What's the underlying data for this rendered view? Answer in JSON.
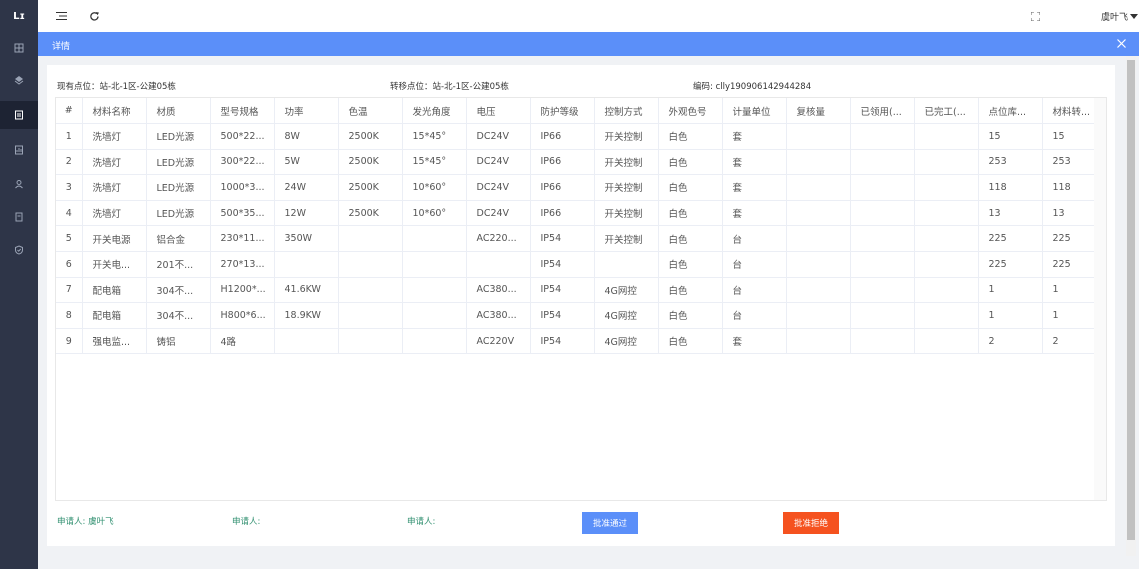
{
  "app": {
    "logo_text": "Lɪ"
  },
  "sidebar": {
    "icons": [
      "grid-icon",
      "layers-icon",
      "report-icon",
      "chart-icon",
      "user-icon",
      "document-icon",
      "shield-icon"
    ],
    "active_index": 2
  },
  "topbar": {
    "user_name": "虞叶飞"
  },
  "modal": {
    "title": "详情",
    "current_location_label": "现有点位：站-北-1区-公建05栋",
    "transfer_location_label": "转移点位：站-北-1区-公建05栋",
    "code_label": "编码: clly190906142944284"
  },
  "table": {
    "headers": [
      "#",
      "材料名称",
      "材质",
      "型号规格",
      "功率",
      "色温",
      "发光角度",
      "电压",
      "防护等级",
      "控制方式",
      "外观色号",
      "计量单位",
      "复核量",
      "已领用(...",
      "已完工(...",
      "点位库...",
      "材料转..."
    ],
    "rows": [
      [
        "1",
        "洗墙灯",
        "LED光源",
        "500*22...",
        "8W",
        "2500K",
        "15*45°",
        "DC24V",
        "IP66",
        "开关控制",
        "白色",
        "套",
        "",
        "",
        "",
        "15",
        "15"
      ],
      [
        "2",
        "洗墙灯",
        "LED光源",
        "300*22...",
        "5W",
        "2500K",
        "15*45°",
        "DC24V",
        "IP66",
        "开关控制",
        "白色",
        "套",
        "",
        "",
        "",
        "253",
        "253"
      ],
      [
        "3",
        "洗墙灯",
        "LED光源",
        "1000*3...",
        "24W",
        "2500K",
        "10*60°",
        "DC24V",
        "IP66",
        "开关控制",
        "白色",
        "套",
        "",
        "",
        "",
        "118",
        "118"
      ],
      [
        "4",
        "洗墙灯",
        "LED光源",
        "500*35...",
        "12W",
        "2500K",
        "10*60°",
        "DC24V",
        "IP66",
        "开关控制",
        "白色",
        "套",
        "",
        "",
        "",
        "13",
        "13"
      ],
      [
        "5",
        "开关电源",
        "铝合金",
        "230*11...",
        "350W",
        "",
        "",
        "AC220...",
        "IP54",
        "开关控制",
        "白色",
        "台",
        "",
        "",
        "",
        "225",
        "225"
      ],
      [
        "6",
        "开关电...",
        "201不...",
        "270*13...",
        "",
        "",
        "",
        "",
        "IP54",
        "",
        "白色",
        "台",
        "",
        "",
        "",
        "225",
        "225"
      ],
      [
        "7",
        "配电箱",
        "304不...",
        "H1200*...",
        "41.6KW",
        "",
        "",
        "AC380...",
        "IP54",
        "4G网控",
        "白色",
        "台",
        "",
        "",
        "",
        "1",
        "1"
      ],
      [
        "8",
        "配电箱",
        "304不...",
        "H800*6...",
        "18.9KW",
        "",
        "",
        "AC380...",
        "IP54",
        "4G网控",
        "白色",
        "台",
        "",
        "",
        "",
        "1",
        "1"
      ],
      [
        "9",
        "强电监...",
        "铸铝",
        "4路",
        "",
        "",
        "",
        "AC220V",
        "IP54",
        "4G网控",
        "白色",
        "套",
        "",
        "",
        "",
        "2",
        "2"
      ]
    ]
  },
  "footer": {
    "applicant_1": "申请人: 虞叶飞",
    "applicant_2": "申请人:",
    "applicant_3": "申请人:",
    "approve_label": "批准通过",
    "reject_label": "批准拒绝"
  },
  "colors": {
    "accent": "#5b8ff9",
    "danger": "#f5521f",
    "sidebar": "#2e3548"
  }
}
